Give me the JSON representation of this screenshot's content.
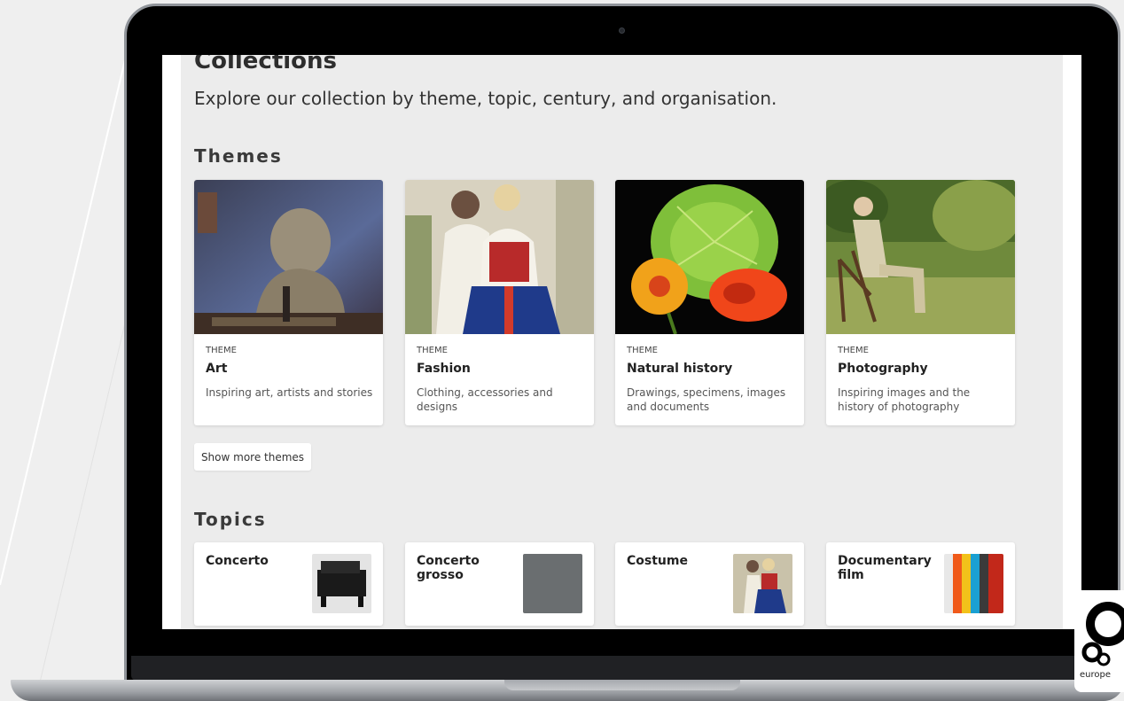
{
  "page": {
    "title": "Collections",
    "description": "Explore our collection by theme, topic, century, and organisation."
  },
  "themes": {
    "heading": "Themes",
    "items": [
      {
        "label": "THEME",
        "name": "Art",
        "description": "Inspiring art, artists and stories",
        "image": "sculpture-bust-painting"
      },
      {
        "label": "THEME",
        "name": "Fashion",
        "description": "Clothing, accessories and designs",
        "image": "two-women-folk-costume"
      },
      {
        "label": "THEME",
        "name": "Natural history",
        "description": "Drawings, specimens, images and documents",
        "image": "nasturtium-flowers"
      },
      {
        "label": "THEME",
        "name": "Photography",
        "description": "Inspiring images and the history of photography",
        "image": "man-seated-in-garden"
      }
    ],
    "more_label": "Show more themes"
  },
  "topics": {
    "heading": "Topics",
    "items": [
      {
        "name": "Concerto",
        "image": "gramophone"
      },
      {
        "name": "Concerto grosso",
        "image": "grey-swatch"
      },
      {
        "name": "Costume",
        "image": "two-women-folk-costume"
      },
      {
        "name": "Documentary film",
        "image": "colour-bars"
      }
    ]
  },
  "brand": {
    "logo_text": "europe",
    "accent": "#000000"
  }
}
